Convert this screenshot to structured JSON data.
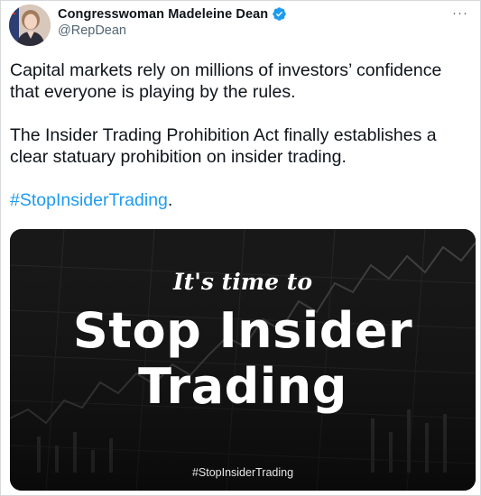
{
  "author": {
    "display_name": "Congresswoman Madeleine Dean",
    "handle": "@RepDean",
    "verified": true,
    "avatar_icon": "profile-photo"
  },
  "menu": {
    "more_label": "···"
  },
  "tweet": {
    "paragraph1": "Capital markets rely on millions of investors’ confidence that everyone is playing by the rules.",
    "paragraph2": "The Insider Trading Prohibition Act finally establishes a clear statuary prohibition on insider trading.",
    "hashtag": "#StopInsiderTrading",
    "hashtag_suffix": "."
  },
  "media": {
    "line_small": "It's time to",
    "line_big_1": "Stop Insider",
    "line_big_2": "Trading",
    "footer_tag": "#StopInsiderTrading"
  },
  "colors": {
    "link": "#1d9bf0",
    "verified_badge": "#1d9bf0",
    "secondary_text": "#536471",
    "media_background": "#141414"
  }
}
